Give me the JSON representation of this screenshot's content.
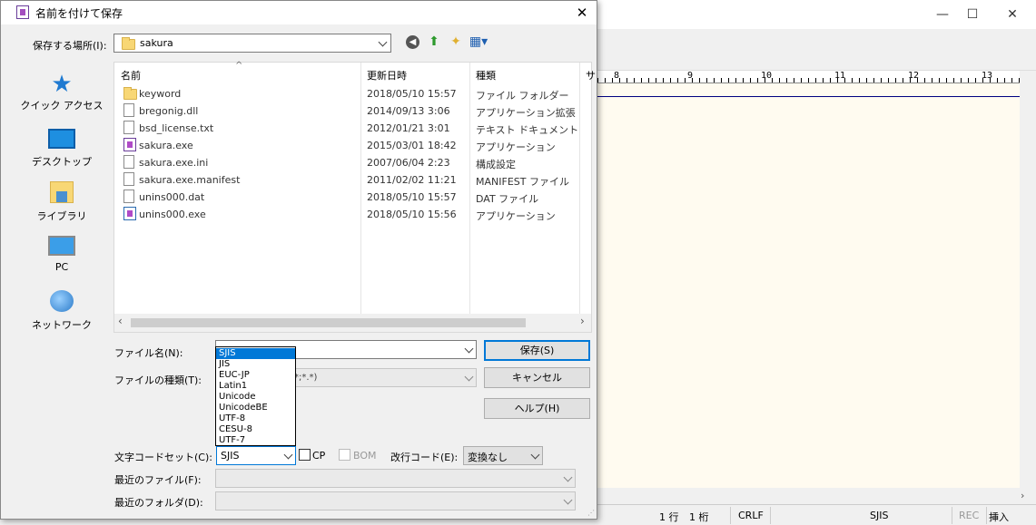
{
  "dialog": {
    "title": "名前を付けて保存",
    "close_glyph": "✕",
    "save_in_label": "保存する場所(I):",
    "save_in_value": "sakura",
    "places": [
      {
        "label": "クイック アクセス",
        "icon": "star-icon"
      },
      {
        "label": "デスクトップ",
        "icon": "desktop-icon"
      },
      {
        "label": "ライブラリ",
        "icon": "library-icon"
      },
      {
        "label": "PC",
        "icon": "pc-icon"
      },
      {
        "label": "ネットワーク",
        "icon": "network-icon"
      }
    ],
    "columns": [
      "名前",
      "更新日時",
      "種類",
      "サ"
    ],
    "files": [
      {
        "name": "keyword",
        "date": "2018/05/10 15:57",
        "type": "ファイル フォルダー",
        "icon": "folder-icon"
      },
      {
        "name": "bregonig.dll",
        "date": "2014/09/13 3:06",
        "type": "アプリケーション拡張",
        "icon": "dll-file-icon"
      },
      {
        "name": "bsd_license.txt",
        "date": "2012/01/21 3:01",
        "type": "テキスト ドキュメント",
        "icon": "text-file-icon"
      },
      {
        "name": "sakura.exe",
        "date": "2015/03/01 18:42",
        "type": "アプリケーション",
        "icon": "sakura-app-icon"
      },
      {
        "name": "sakura.exe.ini",
        "date": "2007/06/04 2:23",
        "type": "構成設定",
        "icon": "settings-file-icon"
      },
      {
        "name": "sakura.exe.manifest",
        "date": "2011/02/02 11:21",
        "type": "MANIFEST ファイル",
        "icon": "file-icon"
      },
      {
        "name": "unins000.dat",
        "date": "2018/05/10 15:57",
        "type": "DAT ファイル",
        "icon": "file-icon"
      },
      {
        "name": "unins000.exe",
        "date": "2018/05/10 15:56",
        "type": "アプリケーション",
        "icon": "installer-icon"
      }
    ],
    "filename_label": "ファイル名(N):",
    "filetype_label": "ファイルの種類(T):",
    "filetype_value_visible": "*;*.*)",
    "save_button": "保存(S)",
    "cancel_button": "キャンセル",
    "help_button": "ヘルプ(H)",
    "charset_label": "文字コードセット(C):",
    "charset_value": "SJIS",
    "cp_label": "CP",
    "bom_label": "BOM",
    "newline_label": "改行コード(E):",
    "newline_value": "変換なし",
    "recent_files_label": "最近のファイル(F):",
    "recent_folders_label": "最近のフォルダ(D):",
    "charset_options": [
      "SJIS",
      "JIS",
      "EUC-JP",
      "Latin1",
      "Unicode",
      "UnicodeBE",
      "UTF-8",
      "CESU-8",
      "UTF-7"
    ],
    "charset_selected": "SJIS"
  },
  "editor": {
    "ruler_numbers": [
      "8",
      "9",
      "10",
      "11",
      "12",
      "13"
    ],
    "status": {
      "line": "1 行",
      "col": "1 桁",
      "newline": "CRLF",
      "encoding": "SJIS",
      "rec": "REC",
      "insert": "挿入"
    },
    "window_controls": [
      "—",
      "☐",
      "✕"
    ]
  }
}
